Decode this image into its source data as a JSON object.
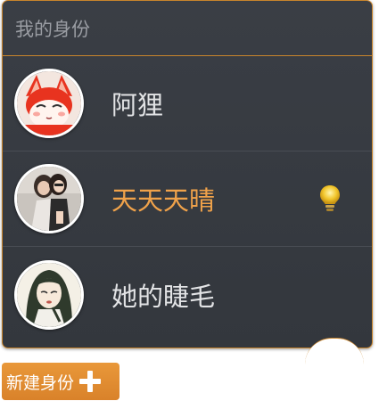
{
  "panel": {
    "title": "我的身份"
  },
  "identities": [
    {
      "name": "阿狸",
      "avatar": "fox-avatar",
      "active": false
    },
    {
      "name": "天天天晴",
      "avatar": "girls-photo-avatar",
      "active": true,
      "indicator": "lightbulb-icon"
    },
    {
      "name": "她的睫毛",
      "avatar": "girl-illustration-avatar",
      "active": false
    }
  ],
  "new_identity_button": {
    "label": "新建身份",
    "icon": "plus-icon"
  },
  "colors": {
    "accent": "#f0a24a",
    "panel_bg": "#3a3e45",
    "button_bg": "#e08c30"
  }
}
